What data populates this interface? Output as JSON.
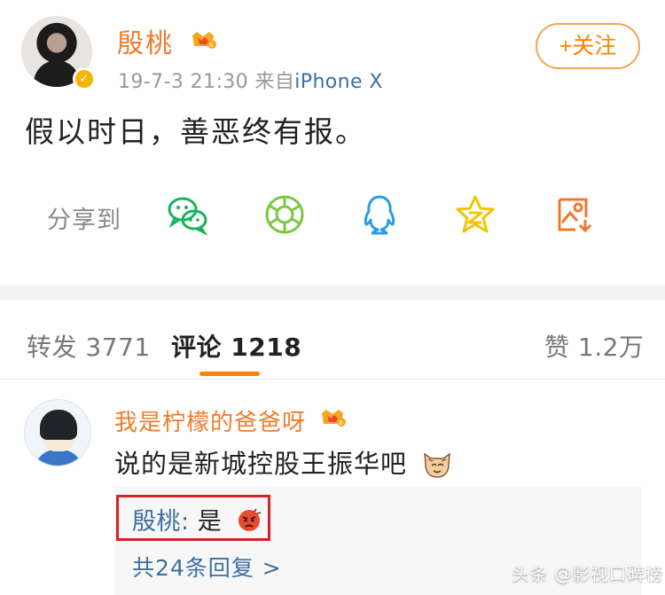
{
  "post": {
    "author": "殷桃",
    "time": "19-7-3 21:30",
    "source_prefix": "来自",
    "source": "iPhone X",
    "follow_label": "+关注",
    "content": "假以时日，善恶终有报。"
  },
  "share": {
    "label": "分享到",
    "icons": [
      "wechat-icon",
      "moments-icon",
      "qq-icon",
      "qzone-icon",
      "save-image-icon"
    ]
  },
  "tabs": {
    "repost": "转发 3771",
    "comments": "评论 1218",
    "likes": "赞 1.2万"
  },
  "comment": {
    "author": "我是柠檬的爸爸呀",
    "text": "说的是新城控股王振华吧",
    "reply": {
      "name": "殷桃",
      "separator": ":",
      "text": "是"
    },
    "more_replies": "共24条回复 >"
  },
  "watermark": "头条 @影视口碑榜",
  "colors": {
    "accent": "#ff8200",
    "author": "#f07c2a",
    "link": "#3d6fa3",
    "highlight": "#d12525"
  }
}
